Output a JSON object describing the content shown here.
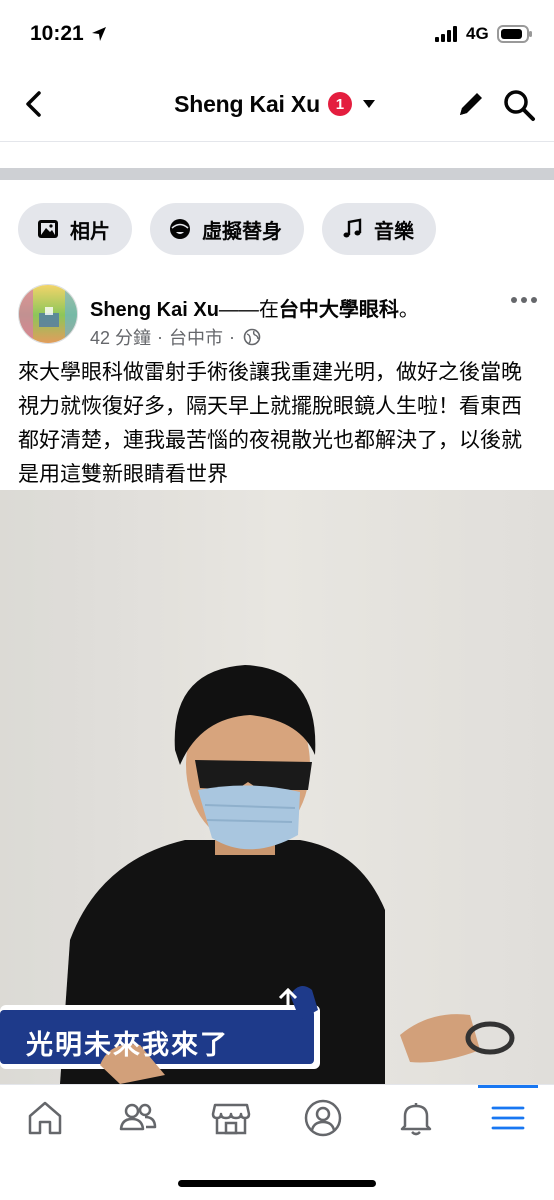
{
  "status_bar": {
    "time": "10:21",
    "network": "4G"
  },
  "header": {
    "title": "Sheng Kai Xu",
    "notification_count": "1"
  },
  "chips": [
    {
      "label": "相片",
      "icon": "photo-icon"
    },
    {
      "label": "虛擬替身",
      "icon": "avatar-face-icon"
    },
    {
      "label": "音樂",
      "icon": "music-note-icon"
    }
  ],
  "post": {
    "author": "Sheng Kai Xu",
    "connector": "——在",
    "place": "台中大學眼科",
    "period": "。",
    "time": "42 分鐘",
    "location": "台中市",
    "body": "來大學眼科做雷射手術後讓我重建光明，做好之後當晚視力就恢復好多，隔天早上就擺脫眼鏡人生啦！看東西都好清楚，連我最苦惱的夜視散光也都解決了，以後就是用這雙新眼睛看世界",
    "sign_text": "光明未來我來了"
  },
  "tabbar": {
    "items": [
      "home-icon",
      "friends-icon",
      "marketplace-icon",
      "profile-icon",
      "notifications-bell-icon",
      "menu-icon"
    ],
    "active": "menu-icon"
  },
  "colors": {
    "accent": "#1877f2",
    "badge": "#e41e3f",
    "chip_bg": "#e4e6eb",
    "meta": "#65676b",
    "sign_bg": "#1e3a8a"
  }
}
